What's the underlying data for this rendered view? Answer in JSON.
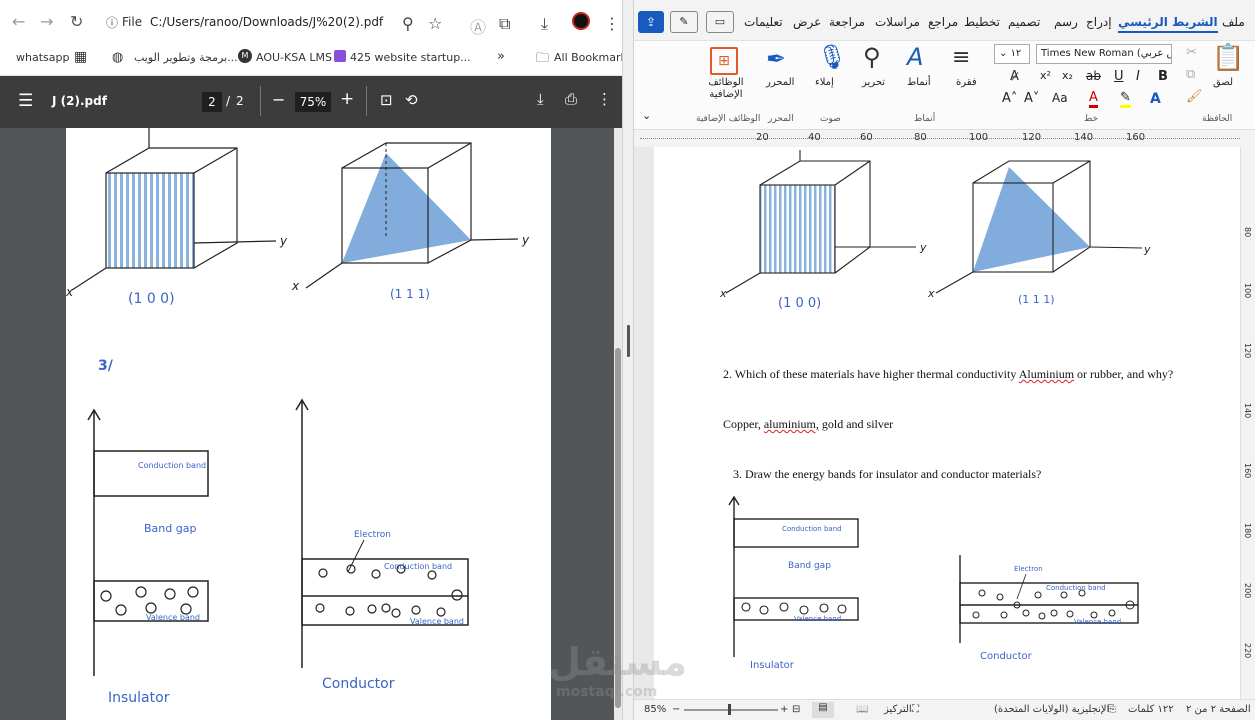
{
  "browser": {
    "url_label": "File",
    "url": "C:/Users/ranoo/Downloads/J%20(2).pdf",
    "bookmarks": [
      {
        "label": "whatsapp"
      },
      {
        "label": "برمجة وتطوير الويب..."
      },
      {
        "label": "AOU-KSA LMS"
      },
      {
        "label": "425 website startup..."
      }
    ],
    "all_bookmarks": "All Bookmarks",
    "more": "»"
  },
  "pdf": {
    "filename": "J (2).pdf",
    "page_current": "2",
    "page_sep": "/",
    "page_total": "2",
    "zoom": "75%",
    "labels": {
      "l100": "(1 0 0)",
      "l111": "(1 1 1)",
      "q3": "3/",
      "conduction_band": "Conduction band",
      "band_gap": "Band gap",
      "valence_band": "Valence band",
      "electron": "Electron",
      "insulator": "Insulator",
      "conductor": "Conductor",
      "axis_x": "x",
      "axis_y": "y"
    }
  },
  "word": {
    "tabs": [
      "ملف",
      "الشريط الرئيسي",
      "إدراج",
      "رسم",
      "تصميم",
      "تخطيط",
      "مراجع",
      "مراسلات",
      "مراجعة",
      "عرض",
      "تعليمات"
    ],
    "ribbon": {
      "paste": "لصق",
      "clipboard": "الحافظة",
      "font_name": "Times New Roman (نص عربي)",
      "font_size": "١٢",
      "font_group": "خط",
      "paragraph": "فقرة",
      "styles": "أنماط",
      "styles_group": "أنماط",
      "editing": "تحرير",
      "dictate": "إملاء",
      "voice": "صوت",
      "editor": "المحرر",
      "editor_group": "المحرر",
      "addins": "الوظائف الإضافية",
      "addins_group": "الوظائف الإضافية"
    },
    "ruler": [
      "160",
      "140",
      "120",
      "100",
      "80",
      "60",
      "40",
      "20"
    ],
    "vruler": [
      "80",
      "100",
      "120",
      "140",
      "160",
      "180",
      "200",
      "220"
    ],
    "doc": {
      "q2": "2. Which of these materials have higher thermal conductivity",
      "q2_aluminium": "Aluminium",
      "q2_rest": "or rubber, and why?",
      "a2_pre": "Copper,",
      "a2_aluminium": "aluminium,",
      "a2_rest": "gold and silver",
      "q3": "3. Draw the energy bands for insulator and conductor materials?",
      "labels": {
        "l100": "(1 0 0)",
        "l111": "(1 1 1)",
        "conduction_band": "Conduction band",
        "band_gap": "Band gap",
        "valence_band": "Valence band",
        "electron": "Electron",
        "insulator": "Insulator",
        "conductor": "Conductor",
        "axis_x": "x",
        "axis_y": "y"
      }
    },
    "status": {
      "page": "الصفحة ٢ من ٢",
      "words": "١٢٢ كلمات",
      "language": "الإنجليزية (الولايات المتحدة)",
      "focus": "التركيز",
      "zoom": "85%"
    }
  },
  "watermark": {
    "main": "مستقل",
    "sub": "mostaql.com"
  },
  "colors": {
    "pdf_toolbar": "#3c3c3c",
    "pdf_bg": "#525659",
    "word_accent": "#185abd",
    "hand_blue": "#3a64c8"
  }
}
